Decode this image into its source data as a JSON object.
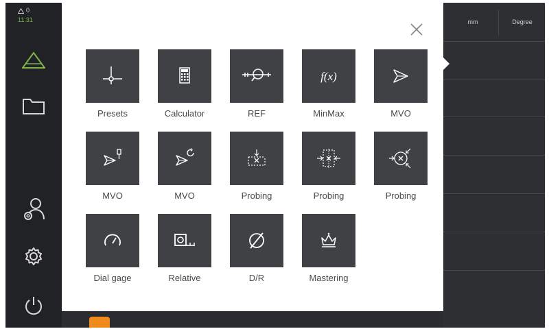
{
  "status": {
    "warning_count": "0",
    "time": "11:31"
  },
  "sidebar": {
    "items": [
      {
        "name": "measure-icon"
      },
      {
        "name": "folder-icon"
      },
      {
        "name": "user-settings-icon"
      },
      {
        "name": "gear-icon"
      },
      {
        "name": "power-icon"
      }
    ]
  },
  "columns": {
    "unit_mm": "mm",
    "unit_degree": "Degree"
  },
  "dialog": {
    "tiles": [
      {
        "label": "Presets",
        "icon": "preset-crosshair-icon"
      },
      {
        "label": "Calculator",
        "icon": "calculator-icon"
      },
      {
        "label": "REF",
        "icon": "ref-icon"
      },
      {
        "label": "MinMax",
        "icon": "fx-icon"
      },
      {
        "label": "MVO",
        "icon": "mvo-arrow-icon"
      },
      {
        "label": "MVO",
        "icon": "mvo-probe-icon"
      },
      {
        "label": "MVO",
        "icon": "mvo-rotate-icon"
      },
      {
        "label": "Probing",
        "icon": "probing-edge-icon"
      },
      {
        "label": "Probing",
        "icon": "probing-center-icon"
      },
      {
        "label": "Probing",
        "icon": "probing-circle-icon"
      },
      {
        "label": "Dial gage",
        "icon": "dial-gage-icon"
      },
      {
        "label": "Relative",
        "icon": "relative-icon"
      },
      {
        "label": "D/R",
        "icon": "diameter-icon"
      },
      {
        "label": "Mastering",
        "icon": "mastering-crown-icon"
      }
    ]
  },
  "colors": {
    "accent_green": "#7fb34d",
    "accent_orange": "#f08a1c",
    "tile_bg": "#3f4145"
  }
}
